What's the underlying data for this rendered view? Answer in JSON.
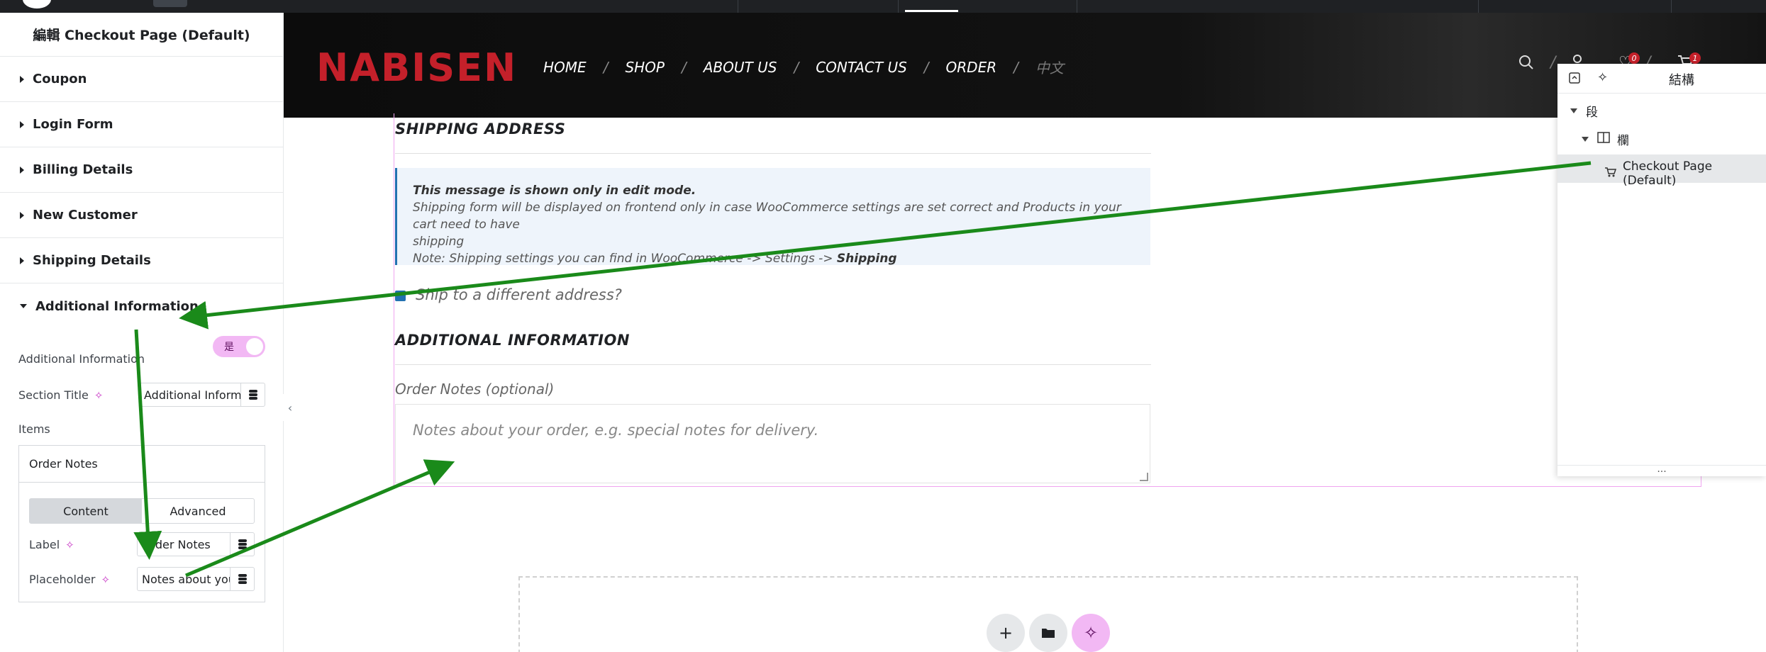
{
  "panel": {
    "title": "編輯 Checkout Page (Default)",
    "sections": [
      "Coupon",
      "Login Form",
      "Billing Details",
      "New Customer",
      "Shipping Details"
    ],
    "open_section": "Additional Information",
    "additional_info_label": "Additional Information",
    "toggle_value": "是",
    "section_title_label": "Section Title",
    "section_title_value": "Additional Informa",
    "items_label": "Items",
    "item_name": "Order Notes",
    "tab_content": "Content",
    "tab_advanced": "Advanced",
    "label_label": "Label",
    "label_value": "Order Notes",
    "placeholder_label": "Placeholder",
    "placeholder_value": "Notes about you"
  },
  "site": {
    "brand": "NABISEN",
    "nav": [
      "HOME",
      "SHOP",
      "ABOUT US",
      "CONTACT US",
      "ORDER",
      "中文"
    ],
    "wishlist_count": "0",
    "cart_count": "1"
  },
  "checkout": {
    "shipping_title": "SHIPPING ADDRESS",
    "notice_strong": "This message is shown only in edit mode.",
    "notice_line1": "Shipping form will be displayed on frontend only in case WooCommerce settings are set correct and Products in your cart need to have",
    "notice_line2": "shipping",
    "notice_line3_prefix": "Note: Shipping settings you can find in WooCommerce -> Settings -> ",
    "notice_line3_bold": "Shipping",
    "ship_different": "Ship to a different address?",
    "additional_title": "ADDITIONAL INFORMATION",
    "order_notes_label": "Order Notes (optional)",
    "order_notes_placeholder": "Notes about your order, e.g. special notes for delivery."
  },
  "structure": {
    "title": "結構",
    "section": "段",
    "column": "欄",
    "widget": "Checkout Page (Default)",
    "more": "..."
  },
  "colors": {
    "brand_red": "#c4202a",
    "arrow_green": "#1a8a1a",
    "toggle_pink": "#f2b8f4",
    "ai_magenta": "#c837c6",
    "notice_blue": "#2271b1"
  }
}
